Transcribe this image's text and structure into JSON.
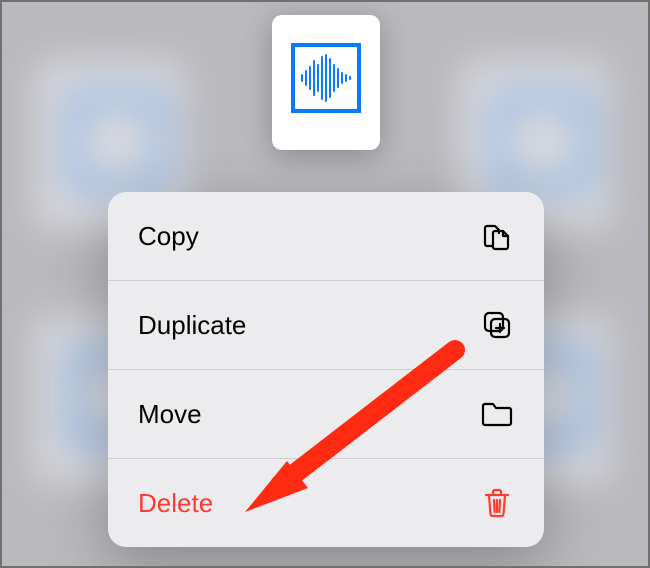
{
  "file": {
    "kind": "audio",
    "icon": "waveform-icon"
  },
  "menu": {
    "items": [
      {
        "label": "Copy",
        "icon": "copy-icon",
        "destructive": false
      },
      {
        "label": "Duplicate",
        "icon": "duplicate-icon",
        "destructive": false
      },
      {
        "label": "Move",
        "icon": "folder-icon",
        "destructive": false
      },
      {
        "label": "Delete",
        "icon": "trash-icon",
        "destructive": true
      }
    ]
  },
  "annotation": {
    "type": "arrow",
    "color": "#ff2a12",
    "points_to": "menu-item-delete"
  },
  "colors": {
    "accent": "#0a7aff",
    "destructive": "#ff3b30",
    "menu_bg": "#ececee",
    "separator": "#cfcfd3",
    "backdrop": "#b9b9be"
  }
}
